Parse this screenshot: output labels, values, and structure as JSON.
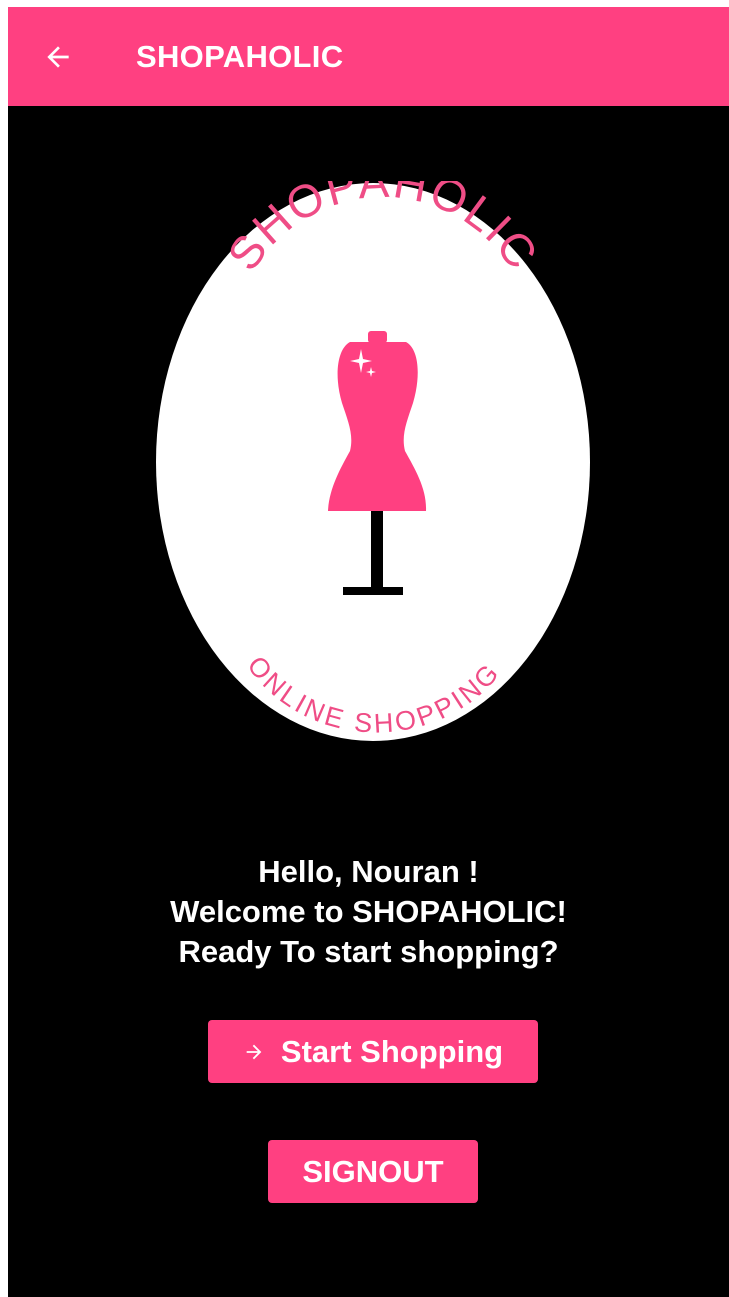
{
  "app_bar": {
    "title": "SHOPAHOLIC",
    "back_icon": "arrow-left-icon"
  },
  "logo": {
    "top_text": "SHOPAHOLIC",
    "bottom_text": "ONLINE SHOPPING",
    "icon": "dress-mannequin-icon"
  },
  "welcome": {
    "line1": "Hello, Nouran !",
    "line2": "Welcome to SHOPAHOLIC!",
    "line3": "Ready To start shopping?"
  },
  "buttons": {
    "start_label": "Start Shopping",
    "start_icon": "arrow-right-icon",
    "signout_label": "SIGNOUT"
  },
  "colors": {
    "accent": "#ff4081",
    "background": "#000000",
    "text": "#ffffff"
  }
}
